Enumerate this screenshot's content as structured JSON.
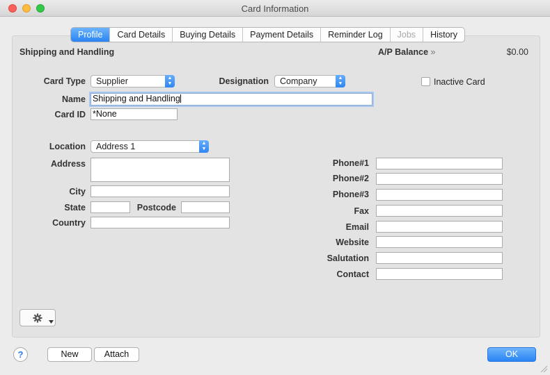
{
  "window": {
    "title": "Card Information"
  },
  "tabs": [
    {
      "label": "Profile",
      "state": "active"
    },
    {
      "label": "Card Details",
      "state": "normal"
    },
    {
      "label": "Buying Details",
      "state": "normal"
    },
    {
      "label": "Payment Details",
      "state": "normal"
    },
    {
      "label": "Reminder Log",
      "state": "normal"
    },
    {
      "label": "Jobs",
      "state": "disabled"
    },
    {
      "label": "History",
      "state": "normal"
    }
  ],
  "header": {
    "card_name": "Shipping and Handling",
    "balance_label": "A/P Balance",
    "balance_chevron": "»",
    "balance_value": "$0.00"
  },
  "form": {
    "card_type_label": "Card Type",
    "card_type_value": "Supplier",
    "designation_label": "Designation",
    "designation_value": "Company",
    "inactive_label": "Inactive Card",
    "inactive_checked": false,
    "name_label": "Name",
    "name_value": "Shipping and Handling",
    "card_id_label": "Card ID",
    "card_id_value": "*None"
  },
  "address": {
    "location_label": "Location",
    "location_value": "Address 1",
    "address_label": "Address",
    "address_value": "",
    "city_label": "City",
    "city_value": "",
    "state_label": "State",
    "state_value": "",
    "postcode_label": "Postcode",
    "postcode_value": "",
    "country_label": "Country",
    "country_value": ""
  },
  "contact": {
    "phone1_label": "Phone#1",
    "phone1_value": "",
    "phone2_label": "Phone#2",
    "phone2_value": "",
    "phone3_label": "Phone#3",
    "phone3_value": "",
    "fax_label": "Fax",
    "fax_value": "",
    "email_label": "Email",
    "email_value": "",
    "website_label": "Website",
    "website_value": "",
    "salutation_label": "Salutation",
    "salutation_value": "",
    "contact_label": "Contact",
    "contact_value": ""
  },
  "buttons": {
    "help": "?",
    "new": "New",
    "attach": "Attach",
    "ok": "OK"
  },
  "icons": {
    "gear": "gear-icon",
    "chevron": "chevron-down-icon",
    "help": "question-icon"
  },
  "colors": {
    "accent": "#2a84f4",
    "close": "#fc605b",
    "minimize": "#fdbc40",
    "maximize": "#34c84a"
  }
}
